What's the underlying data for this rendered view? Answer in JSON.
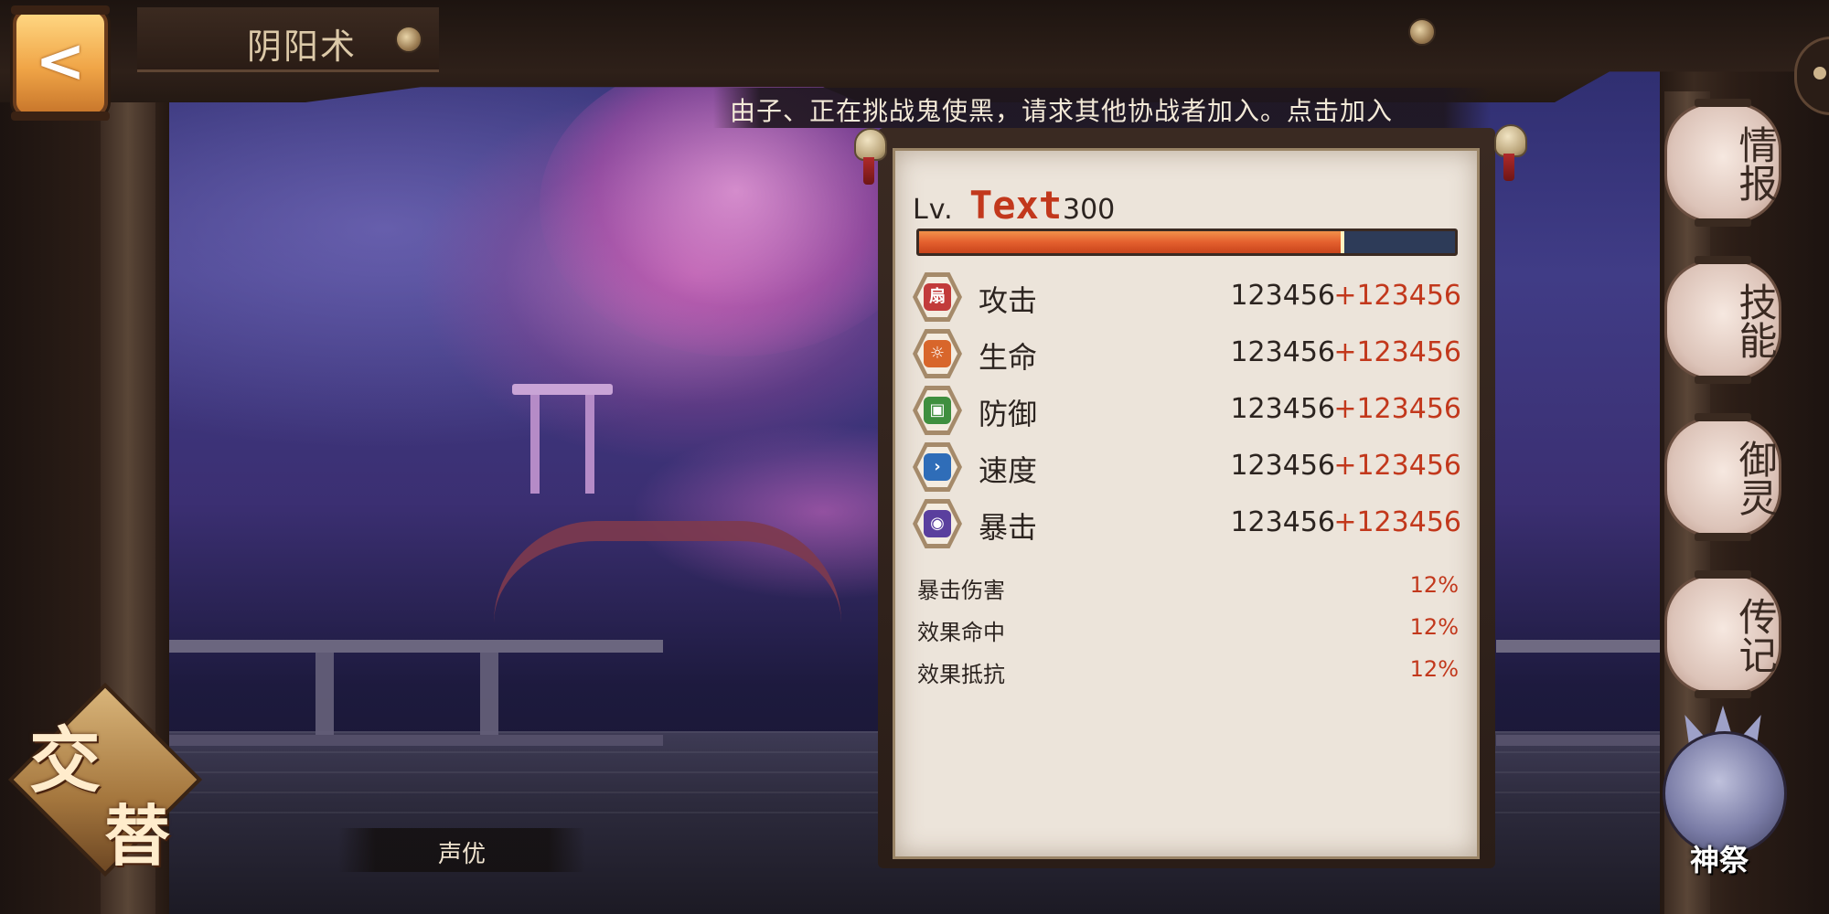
{
  "header": {
    "back_icon": "back-arrow-icon",
    "title": "阴阳术"
  },
  "notice": {
    "text": "由子、正在挑战鬼使黑，请求其他协战者加入。点击加入"
  },
  "stats_panel": {
    "level_prefix": "Lv.",
    "level_name": "Text",
    "level_value": "300",
    "exp_progress": 0.79,
    "main_stats": [
      {
        "icon": "attack-fan-icon",
        "label": "攻击",
        "base": "123456",
        "bonus": "+123456",
        "color": "#c23b3b"
      },
      {
        "icon": "health-scroll-icon",
        "label": "生命",
        "base": "123456",
        "bonus": "+123456",
        "color": "#d8662b"
      },
      {
        "icon": "defense-armor-icon",
        "label": "防御",
        "base": "123456",
        "bonus": "+123456",
        "color": "#3f8f3f"
      },
      {
        "icon": "speed-arrow-icon",
        "label": "速度",
        "base": "123456",
        "bonus": "+123456",
        "color": "#2f6db8"
      },
      {
        "icon": "crit-banner-icon",
        "label": "暴击",
        "base": "123456",
        "bonus": "+123456",
        "color": "#5a3f9e"
      }
    ],
    "sub_stats": [
      {
        "label": "暴击伤害",
        "value": "12%"
      },
      {
        "label": "效果命中",
        "value": "12%"
      },
      {
        "label": "效果抵抗",
        "value": "12%"
      }
    ]
  },
  "side_menu": [
    {
      "label": "情报"
    },
    {
      "label": "技能"
    },
    {
      "label": "御灵"
    },
    {
      "label": "传记"
    }
  ],
  "bottom": {
    "swap_label_1": "交",
    "swap_label_2": "替",
    "voice_label": "声优",
    "festival_label": "神祭",
    "festival_icon": "dragon-emblem-icon"
  },
  "colors": {
    "accent_red": "#c2381c",
    "panel_bg": "#ece4da",
    "exp_fill": "#e4602e",
    "exp_track": "#2d3b58"
  }
}
